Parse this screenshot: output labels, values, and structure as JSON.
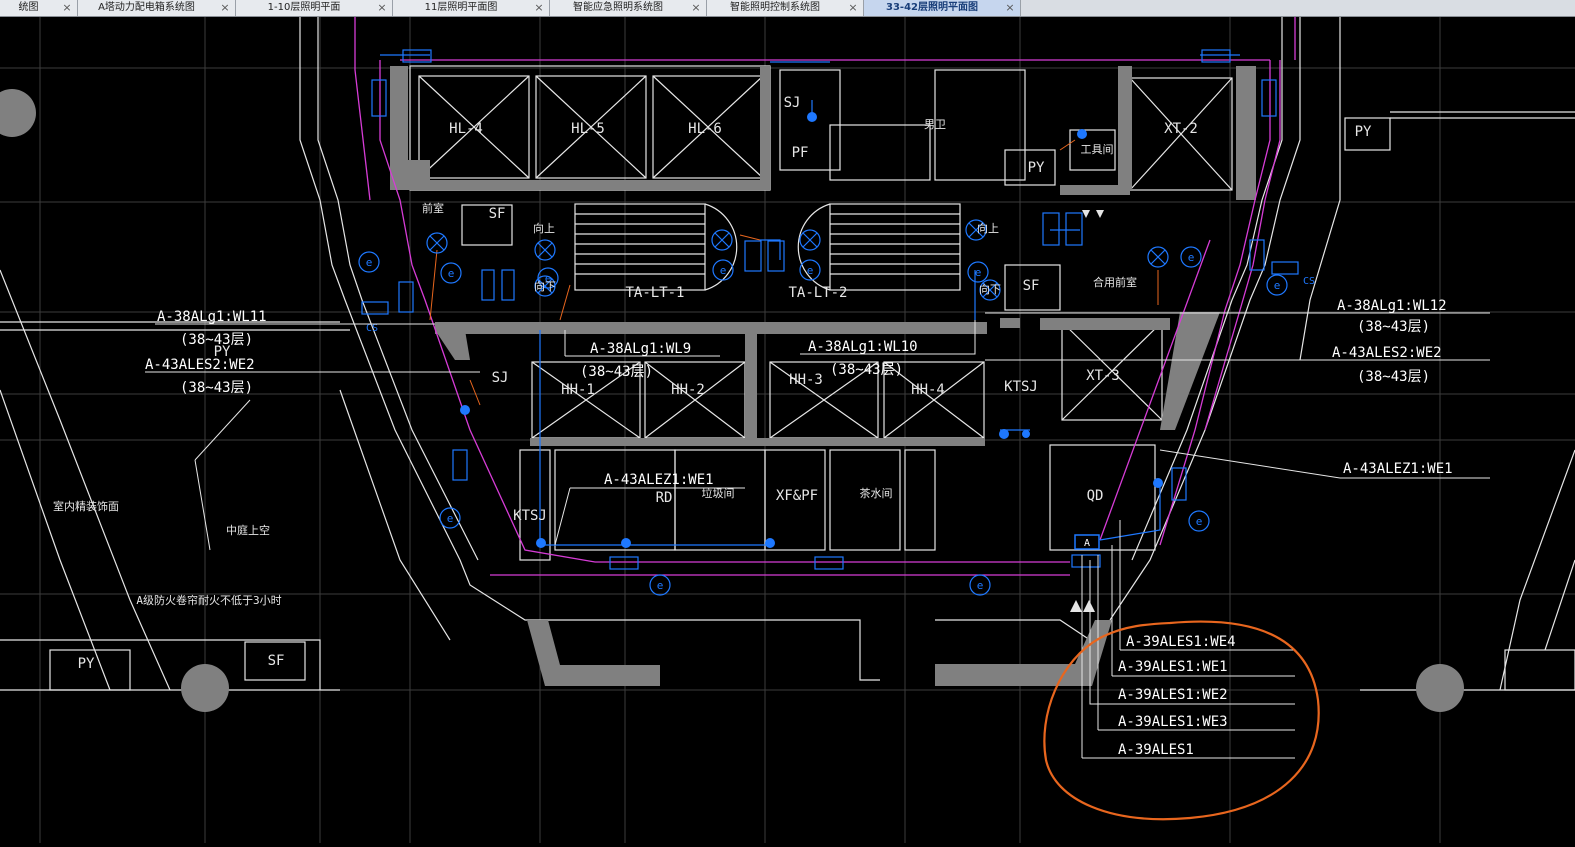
{
  "tabs": [
    {
      "label": "统图",
      "active": false
    },
    {
      "label": "A塔动力配电箱系统图",
      "active": false
    },
    {
      "label": "1-10层照明平面",
      "active": false
    },
    {
      "label": "11层照明平面图",
      "active": false
    },
    {
      "label": "智能应急照明系统图",
      "active": false
    },
    {
      "label": "智能照明控制系统图",
      "active": false
    },
    {
      "label": "33-42层照明平面图",
      "active": true
    }
  ],
  "tab_close_glyph": "×",
  "colors": {
    "background": "#000000",
    "wall_fill": "#808080",
    "line_white": "#e6e6e6",
    "grid": "#3c3c3c",
    "magenta": "#d63cd6",
    "blue": "#1e78ff",
    "orange_markup": "#e8661e",
    "label_white": "#ffffff"
  },
  "rooms": {
    "hl4": "HL-4",
    "hl5": "HL-5",
    "hl6": "HL-6",
    "xt2": "XT-2",
    "xt3": "XT-3",
    "hh1": "HH-1",
    "hh2": "HH-2",
    "hh3": "HH-3",
    "hh4": "HH-4",
    "talt1": "TA-LT-1",
    "talt2": "TA-LT-2",
    "sj_top": "SJ",
    "sj_left": "SJ",
    "pf": "PF",
    "py_top": "PY",
    "py_right": "PY",
    "py_left": "PY",
    "py_bottom": "PY",
    "sf_top": "SF",
    "sf_right": "SF",
    "sf_bottom": "SF",
    "qianshi": "前室",
    "hexi": "合用前室",
    "xiangshang_left": "向上",
    "xiangxia_left": "向下",
    "xiangshang_right": "向上",
    "xiangxia_right": "向下",
    "nanwei": "男卫",
    "gongju": "工具间",
    "ktsj_right": "KTSJ",
    "ktsj_left": "KTSJ",
    "rd": "RD",
    "lajijian": "垃圾间",
    "xfpf": "XF&PF",
    "chashui": "茶水间",
    "qd": "QD",
    "zhongting": "中庭上空",
    "shineijingguan": "室内精装饰面",
    "fanghuo": "A级防火卷帘耐火不低于3小时"
  },
  "annotations": {
    "left_wl11": "A-38ALg1:WL11",
    "left_wl11_sub": "(38~43层)",
    "left_we2": "A-43ALES2:WE2",
    "left_we2_sub": "(38~43层)",
    "mid_wl9": "A-38ALg1:WL9",
    "mid_wl9_sub": "(38~43层)",
    "mid_wl10": "A-38ALg1:WL10",
    "mid_wl10_sub": "(38~43层)",
    "right_wl12": "A-38ALg1:WL12",
    "right_wl12_sub": "(38~43层)",
    "right_we2": "A-43ALES2:WE2",
    "right_we2_sub": "(38~43层)",
    "alez1_left": "A-43ALEZ1:WE1",
    "alez1_right": "A-43ALEZ1:WE1",
    "we4": "A-39ALES1:WE4",
    "we1": "A-39ALES1:WE1",
    "we2": "A-39ALES1:WE2",
    "we3": "A-39ALES1:WE3",
    "ales1": "A-39ALES1"
  },
  "symbols": {
    "emergency_light_letter": "e",
    "panel_letter": "A",
    "cs_left": "CS",
    "cs_right": "CS"
  }
}
